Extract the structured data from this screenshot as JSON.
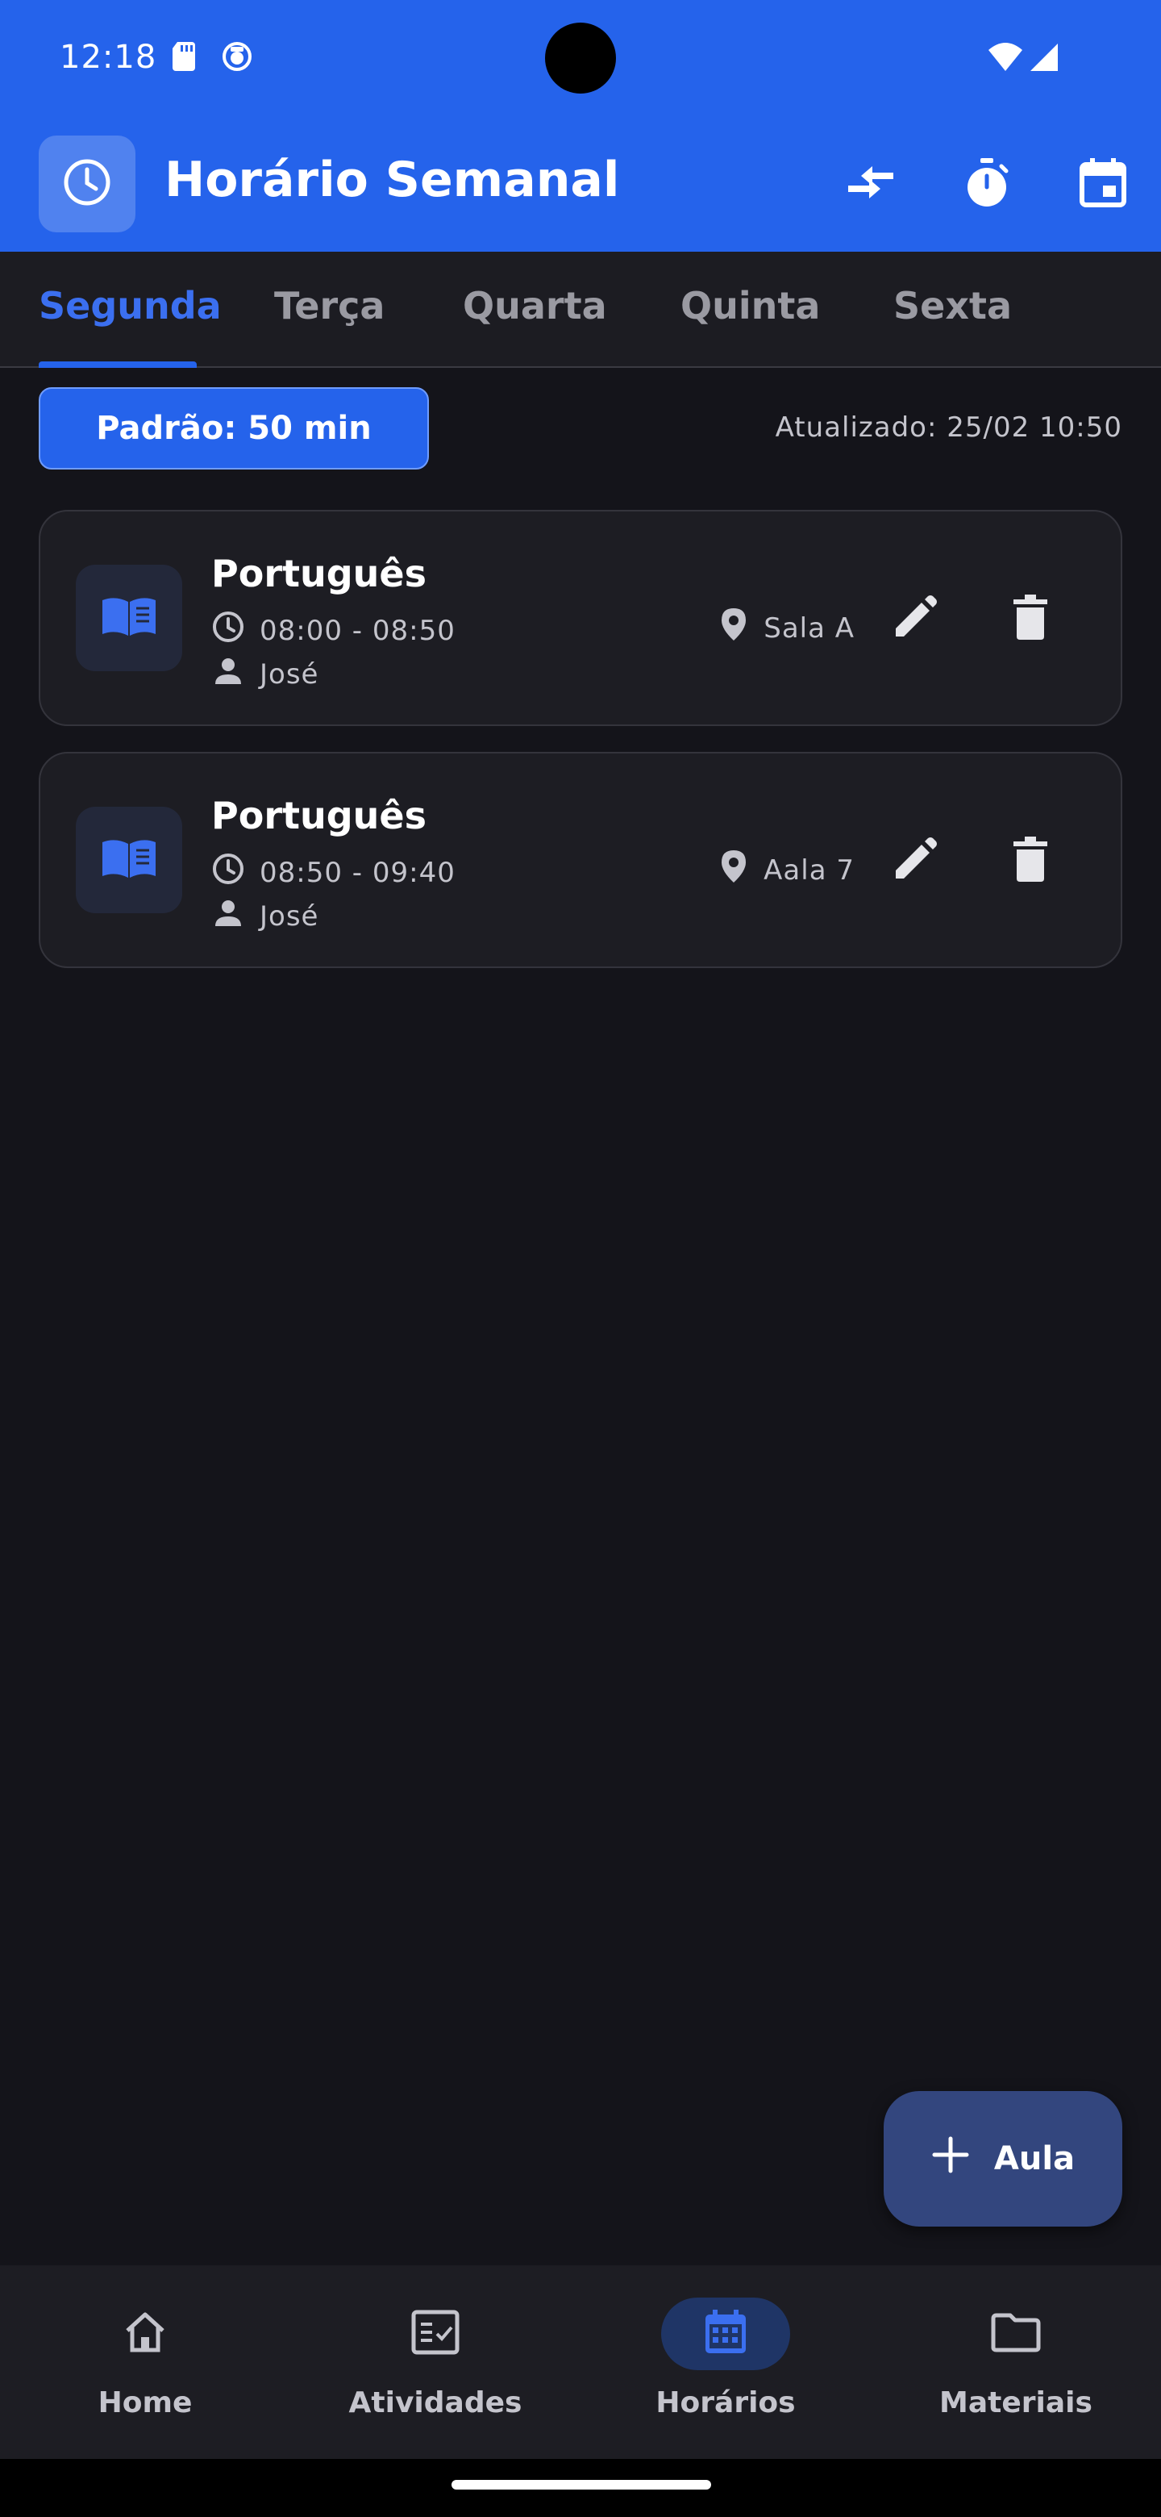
{
  "status_bar": {
    "time": "12:18",
    "icons": [
      "sd-card-icon",
      "notification-icon",
      "wifi-icon",
      "signal-icon"
    ]
  },
  "app_bar": {
    "title": "Horário Semanal",
    "logo_icon": "clock-icon",
    "actions": [
      "compare-arrows-icon",
      "timer-icon",
      "calendar-today-icon"
    ]
  },
  "tabs": [
    {
      "label": "Segunda",
      "active": true
    },
    {
      "label": "Terça",
      "active": false
    },
    {
      "label": "Quarta",
      "active": false
    },
    {
      "label": "Quinta",
      "active": false
    },
    {
      "label": "Sexta",
      "active": false
    }
  ],
  "toolbar": {
    "default_duration": "Padrão: 50 min",
    "updated": "Atualizado: 25/02 10:50"
  },
  "classes": [
    {
      "subject": "Português",
      "time": "08:00 - 08:50",
      "teacher": "José",
      "room": "Sala A"
    },
    {
      "subject": "Português",
      "time": "08:50 - 09:40",
      "teacher": "José",
      "room": "Aala 7"
    }
  ],
  "fab": {
    "label": "Aula",
    "icon": "plus-icon"
  },
  "bottom_nav": [
    {
      "label": "Home",
      "icon": "home-icon",
      "active": false
    },
    {
      "label": "Atividades",
      "icon": "activities-icon",
      "active": false
    },
    {
      "label": "Horários",
      "icon": "calendar-icon",
      "active": true
    },
    {
      "label": "Materiais",
      "icon": "folder-icon",
      "active": false
    }
  ],
  "colors": {
    "primary": "#2563eb",
    "background": "#14141a",
    "card": "#1d1d23",
    "active_tab": "#3b6ff0",
    "fab": "#33467e"
  }
}
